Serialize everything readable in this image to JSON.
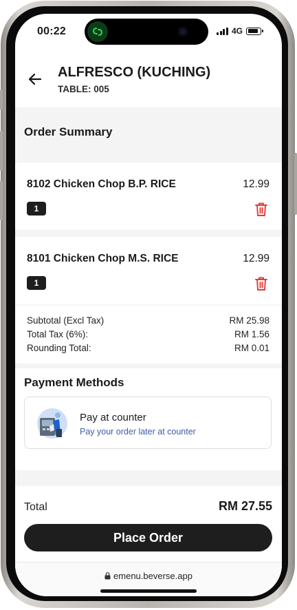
{
  "status_bar": {
    "time": "00:22",
    "network": "4G"
  },
  "header": {
    "shop_name": "ALFRESCO (KUCHING)",
    "table": "TABLE: 005"
  },
  "order_summary": {
    "title": "Order Summary",
    "items": [
      {
        "name": "8102 Chicken Chop B.P. RICE",
        "price": "12.99",
        "qty": "1"
      },
      {
        "name": "8101 Chicken Chop M.S. RICE",
        "price": "12.99",
        "qty": "1"
      }
    ]
  },
  "totals": {
    "subtotal_label": "Subtotal (Excl Tax)",
    "subtotal_value": "RM 25.98",
    "tax_label": "Total Tax (6%):",
    "tax_value": "RM 1.56",
    "rounding_label": "Rounding Total:",
    "rounding_value": "RM 0.01"
  },
  "payment": {
    "title": "Payment Methods",
    "method_title": "Pay at counter",
    "method_subtitle": "Pay your order later at counter"
  },
  "footer": {
    "total_label": "Total",
    "total_value": "RM 27.55",
    "place_order_label": "Place Order",
    "url": "emenu.beverse.app"
  },
  "colors": {
    "accent_dark": "#1e1e1e",
    "delete_red": "#e53935",
    "subtitle_blue": "#3b5ea8",
    "section_bg": "#f4f4f4"
  },
  "icons": {
    "back": "arrow-left-icon",
    "delete": "trash-icon",
    "lock": "lock-icon",
    "app": "link-app-icon"
  }
}
